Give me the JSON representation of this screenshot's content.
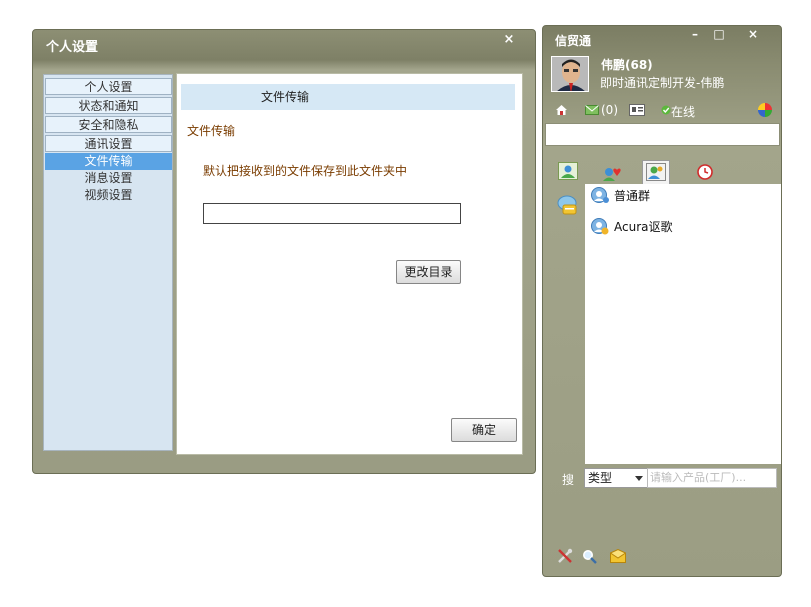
{
  "settings_window": {
    "title": "个人设置",
    "close_glyph": "×",
    "nav": [
      {
        "label": "个人设置",
        "state": "boxed"
      },
      {
        "label": "状态和通知",
        "state": "boxed"
      },
      {
        "label": "安全和隐私",
        "state": "boxed"
      },
      {
        "label": "通讯设置",
        "state": "boxed"
      },
      {
        "label": "文件传输",
        "state": "active"
      },
      {
        "label": "消息设置",
        "state": "plain"
      },
      {
        "label": "视频设置",
        "state": "plain"
      }
    ],
    "panel_header": "文件传输",
    "section_title": "文件传输",
    "description": "默认把接收到的文件保存到此文件夹中",
    "path_value": "",
    "change_dir_label": "更改目录",
    "ok_label": "确定"
  },
  "im_window": {
    "title": "信贸通",
    "minimize_glyph": "–",
    "maximize_glyph": "□",
    "close_glyph": "×",
    "user_name": "伟鹏(68)",
    "signature": "即时通讯定制开发-伟鹏",
    "mail_count": "(0)",
    "status": "在线",
    "search_placeholder": "",
    "groups": [
      {
        "label": "普通群",
        "icon": "group-icon"
      },
      {
        "label": "Acura讴歌",
        "icon": "group-icon"
      }
    ],
    "search_label": "搜",
    "type_select": "类型",
    "product_placeholder": "请输入产品(工厂)...",
    "colors": {
      "title_bar": "#7b7d63",
      "nav_active": "#5aa3e4",
      "panel_header": "#d6e8f5",
      "brown_text": "#7a3c00"
    }
  }
}
